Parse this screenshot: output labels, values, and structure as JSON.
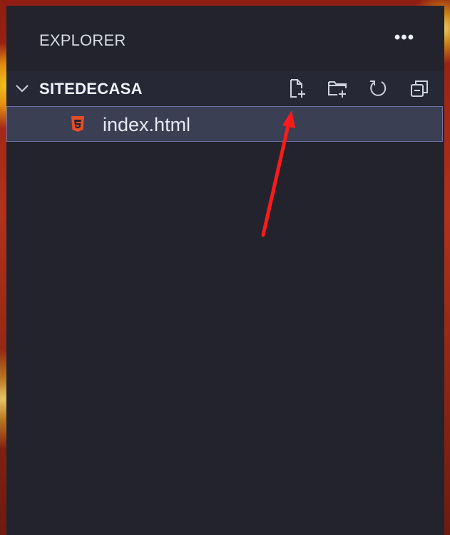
{
  "explorer": {
    "title": "EXPLORER",
    "more_label": "•••",
    "folder_name": "SITEDECASA"
  },
  "files": [
    {
      "name": "index.html",
      "icon": "html5-file-icon"
    }
  ],
  "toolbar": {
    "new_file_icon": "new-file-icon",
    "new_folder_icon": "new-folder-icon",
    "refresh_icon": "refresh-icon",
    "collapse_icon": "collapse-all-icon"
  },
  "colors": {
    "panel_bg": "#23232d",
    "selection_bg": "#3b3f54",
    "selection_border": "#6a74a8",
    "html_icon": "#e44d26",
    "annotation_arrow": "#ff1a1a"
  }
}
